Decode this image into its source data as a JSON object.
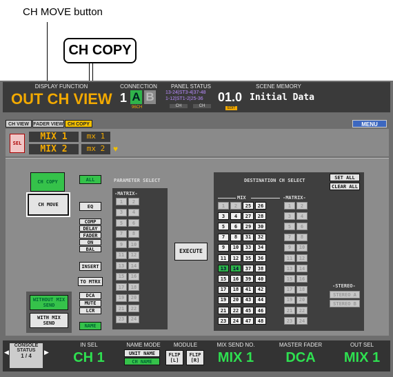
{
  "callouts": {
    "ch_move": "CH MOVE button",
    "ch_copy": "CH COPY"
  },
  "top": {
    "display_function": "DISPLAY FUNCTION",
    "screen": "OUT CH VIEW",
    "connection": "CONNECTION",
    "conn_a": "1",
    "conn_b": "A",
    "conn_c": "B",
    "conn_sub": "96CH",
    "panel_status": "PANEL STATUS",
    "ps1": "13-24|ST3-4|37-48",
    "ps2": "1-12|ST1-2|25-36",
    "ps_ch1": "CH",
    "ps_ch2": "CH",
    "scene_memory": "SCENE MEMORY",
    "scene_no": "01.0",
    "scene_name": "Initial Data",
    "edit": "EDIT"
  },
  "tabs": [
    "CH VIEW",
    "FADER VIEW",
    "CH COPY"
  ],
  "menu": "MENU",
  "sel": {
    "label": "SEL",
    "src": "MIX 1",
    "src_short": "mx 1",
    "dst": "MIX 2",
    "dst_short": "mx 2"
  },
  "buttons": {
    "ch_copy": "CH COPY",
    "ch_move": "CH MOVE",
    "all": "ALL",
    "eq": "EQ",
    "comp": "COMP",
    "delay": "DELAY",
    "fader": "FADER",
    "on": "ON",
    "bal": "BAL",
    "insert": "INSERT",
    "to_mtrx": "TO MTRX",
    "dca": "DCA",
    "mute": "MUTE",
    "lcr": "LCR",
    "name": "NAME",
    "without": "WITHOUT MIX SEND",
    "with": "WITH MIX SEND",
    "execute": "EXECUTE",
    "set_all": "SET ALL",
    "clear_all": "CLEAR ALL",
    "stereo_a": "STEREO A",
    "stereo_b": "STEREO B"
  },
  "param_select": "PARAMETER SELECT",
  "matrix_label": "-MATRIX-",
  "param_matrix": [
    "1",
    "2",
    "3",
    "4",
    "5",
    "6",
    "7",
    "8",
    "9",
    "10",
    "11",
    "12",
    "13",
    "14",
    "15",
    "16",
    "17",
    "18",
    "19",
    "20",
    "21",
    "22",
    "23",
    "24"
  ],
  "dest": {
    "title": "DESTINATION CH SELECT",
    "mix_label": "MIX",
    "matrix_label": "-MATRIX-",
    "stereo_label": "-STEREO-",
    "mix": [
      "1",
      "2",
      "25",
      "26",
      "3",
      "4",
      "27",
      "28",
      "5",
      "6",
      "29",
      "30",
      "7",
      "8",
      "31",
      "32",
      "9",
      "10",
      "33",
      "34",
      "11",
      "12",
      "35",
      "36",
      "13",
      "14",
      "37",
      "38",
      "15",
      "16",
      "39",
      "40",
      "17",
      "18",
      "41",
      "42",
      "19",
      "20",
      "43",
      "44",
      "21",
      "22",
      "45",
      "46",
      "23",
      "24",
      "47",
      "48"
    ],
    "matrix": [
      "1",
      "2",
      "3",
      "4",
      "5",
      "6",
      "7",
      "8",
      "9",
      "10",
      "11",
      "12",
      "13",
      "14",
      "15",
      "16",
      "17",
      "18",
      "19",
      "20",
      "21",
      "22",
      "23",
      "24"
    ]
  },
  "bottom": {
    "console_status": "CONSOLE STATUS",
    "page": "1 / 4",
    "in_sel": "IN SEL",
    "in_val": "CH 1",
    "name_mode": "NAME MODE",
    "unit_name": "UNIT NAME",
    "ch_name": "CH NAME",
    "module": "MODULE",
    "flip_l": "FLIP [L]",
    "flip_r": "FLIP [R]",
    "mix_send": "MIX SEND NO.",
    "mix_val": "MIX 1",
    "master": "MASTER FADER",
    "master_val": "DCA",
    "out_sel": "OUT SEL",
    "out_val": "MIX 1"
  }
}
